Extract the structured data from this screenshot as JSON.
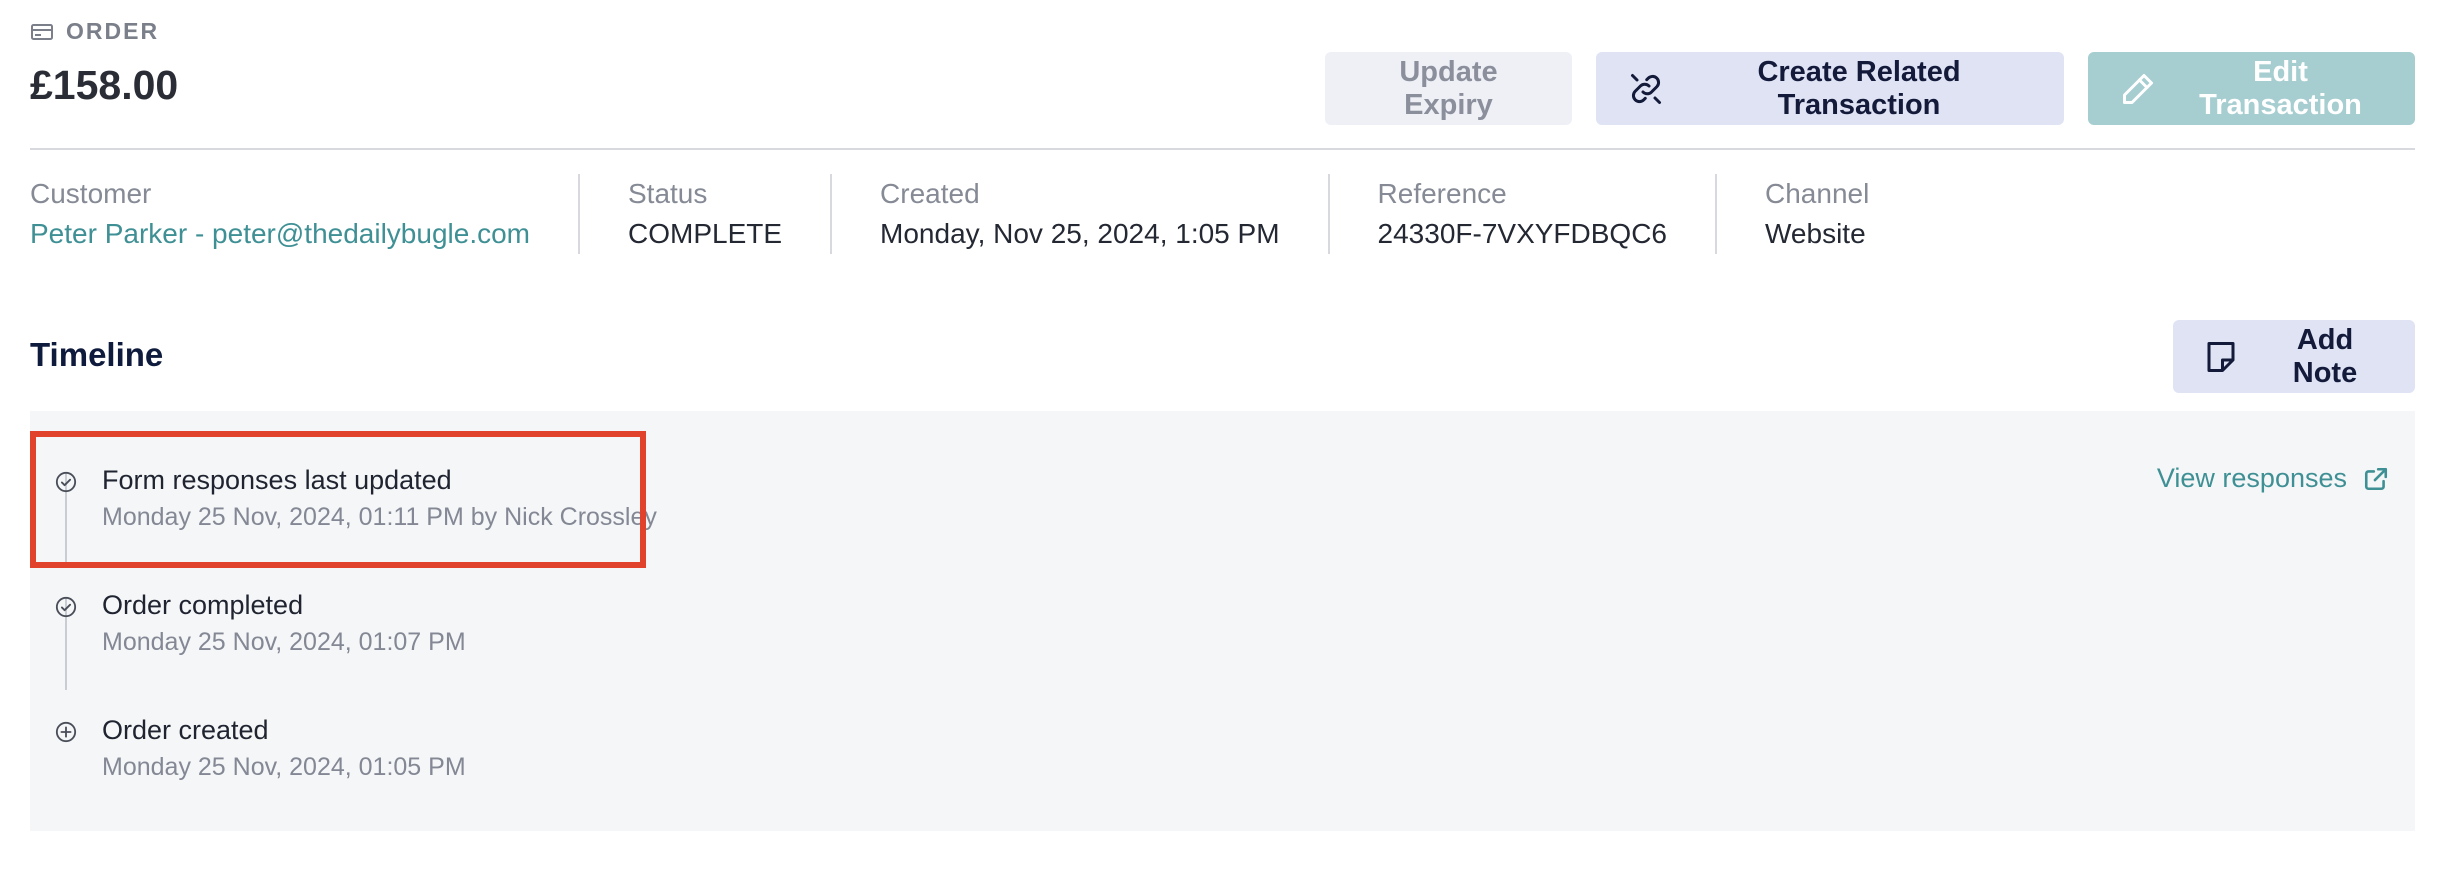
{
  "header": {
    "eyebrow": "ORDER",
    "amount": "£158.00"
  },
  "actions": {
    "update_expiry": "Update Expiry",
    "create_related": "Create Related Transaction",
    "edit_transaction": "Edit Transaction"
  },
  "meta": {
    "customer_label": "Customer",
    "customer_value": "Peter Parker - peter@thedailybugle.com",
    "status_label": "Status",
    "status_value": "COMPLETE",
    "created_label": "Created",
    "created_value": "Monday, Nov 25, 2024, 1:05 PM",
    "reference_label": "Reference",
    "reference_value": "24330F-7VXYFDBQC6",
    "channel_label": "Channel",
    "channel_value": "Website"
  },
  "timeline": {
    "title": "Timeline",
    "add_note": "Add Note",
    "view_responses": "View responses",
    "entries": [
      {
        "title": "Form responses last updated",
        "subtitle": "Monday 25 Nov, 2024, 01:11 PM by Nick Crossley",
        "icon": "check-circle-icon"
      },
      {
        "title": "Order completed",
        "subtitle": "Monday 25 Nov, 2024, 01:07 PM",
        "icon": "check-circle-icon"
      },
      {
        "title": "Order created",
        "subtitle": "Monday 25 Nov, 2024, 01:05 PM",
        "icon": "plus-circle-icon"
      }
    ]
  },
  "colors": {
    "accent": "#3f9095",
    "highlight": "#e0422c",
    "panel": "#f5f6f8"
  }
}
